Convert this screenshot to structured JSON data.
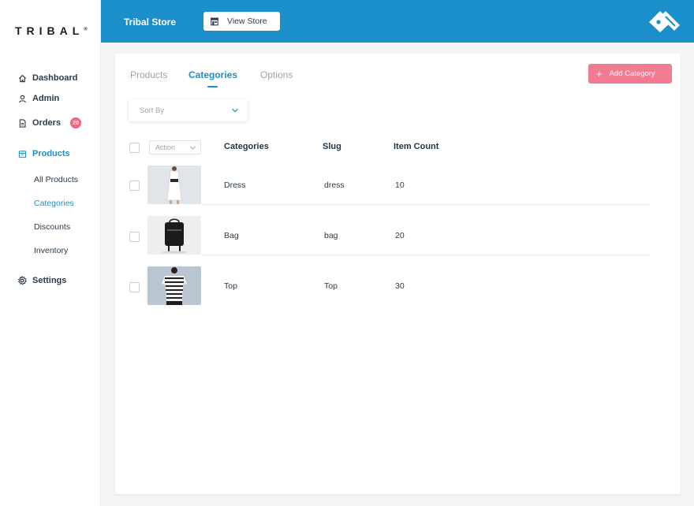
{
  "brand": {
    "logo_text": "TRIBAL",
    "logo_mark": "®"
  },
  "sidebar": {
    "items": [
      {
        "label": "Dashboard",
        "icon": "home-icon"
      },
      {
        "label": "Admin",
        "icon": "user-icon"
      },
      {
        "label": "Orders",
        "icon": "document-icon",
        "badge": "20"
      },
      {
        "label": "Products",
        "icon": "box-icon"
      },
      {
        "label": "Settings",
        "icon": "gear-icon"
      }
    ],
    "sub_items": [
      {
        "label": "All Products"
      },
      {
        "label": "Categories"
      },
      {
        "label": "Discounts"
      },
      {
        "label": "Inventory"
      }
    ]
  },
  "header": {
    "store_title": "Tribal Store",
    "view_store_label": "View Store"
  },
  "main": {
    "tabs": [
      {
        "label": "Products"
      },
      {
        "label": "Categories"
      },
      {
        "label": "Options"
      }
    ],
    "add_category_label": "Add Category",
    "sort_label": "Sort By",
    "action_label": "Action",
    "columns": [
      "Categories",
      "Slug",
      "Item Count"
    ],
    "rows": [
      {
        "name": "Dress",
        "slug": "dress",
        "count": "10"
      },
      {
        "name": "Bag",
        "slug": "bag",
        "count": "20"
      },
      {
        "name": "Top",
        "slug": "Top",
        "count": "30"
      }
    ]
  },
  "colors": {
    "accent": "#1b8fc9",
    "pink": "#f17b91",
    "badge": "#f0677f"
  }
}
